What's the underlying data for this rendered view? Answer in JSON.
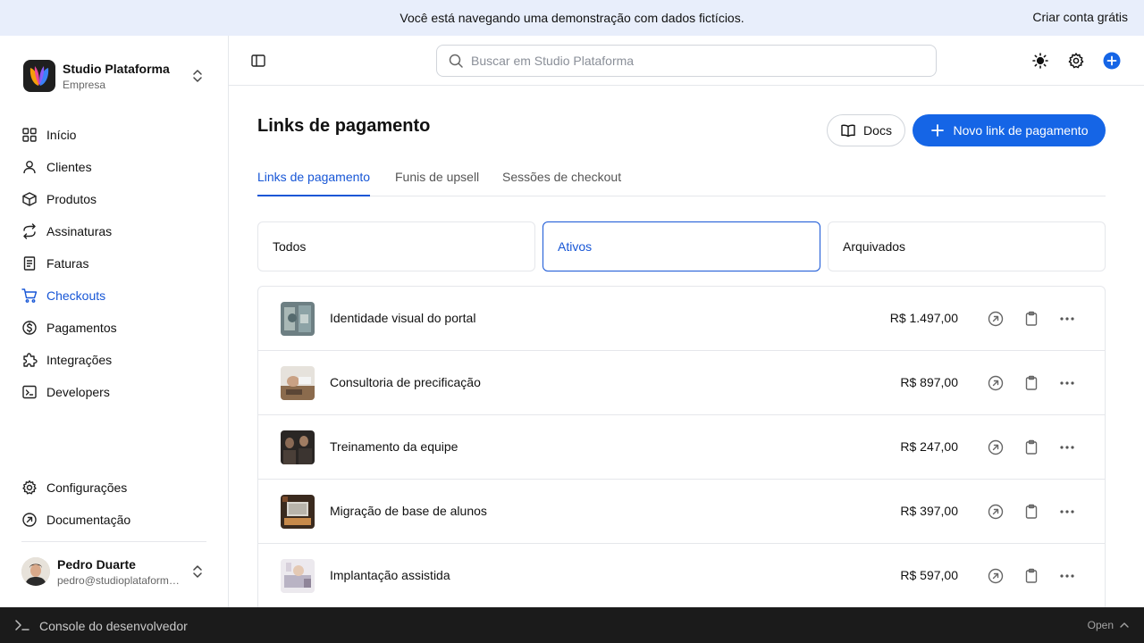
{
  "banner": {
    "message": "Você está navegando uma demonstração com dados fictícios.",
    "cta": "Criar conta grátis"
  },
  "org": {
    "name": "Studio Plataforma",
    "subtitle": "Empresa"
  },
  "sidebar": {
    "items": [
      {
        "label": "Início",
        "icon": "grid-icon"
      },
      {
        "label": "Clientes",
        "icon": "user-icon"
      },
      {
        "label": "Produtos",
        "icon": "box-icon"
      },
      {
        "label": "Assinaturas",
        "icon": "refresh-icon"
      },
      {
        "label": "Faturas",
        "icon": "invoice-icon"
      },
      {
        "label": "Checkouts",
        "icon": "cart-icon",
        "active": true
      },
      {
        "label": "Pagamentos",
        "icon": "dollar-icon"
      },
      {
        "label": "Integrações",
        "icon": "puzzle-icon"
      },
      {
        "label": "Developers",
        "icon": "terminal-icon"
      }
    ],
    "bottom": [
      {
        "label": "Configurações",
        "icon": "gear-icon"
      },
      {
        "label": "Documentação",
        "icon": "external-icon"
      }
    ]
  },
  "user": {
    "name": "Pedro Duarte",
    "email": "pedro@studioplataforma.com"
  },
  "search": {
    "placeholder": "Buscar em Studio Plataforma"
  },
  "page": {
    "title": "Links de pagamento",
    "docs_label": "Docs",
    "new_label": "Novo link de pagamento"
  },
  "tabs": [
    {
      "label": "Links de pagamento",
      "active": true
    },
    {
      "label": "Funis de upsell"
    },
    {
      "label": "Sessões de checkout"
    }
  ],
  "filters": [
    {
      "label": "Todos"
    },
    {
      "label": "Ativos",
      "active": true
    },
    {
      "label": "Arquivados"
    }
  ],
  "links": [
    {
      "name": "Identidade visual do portal",
      "price": "R$ 1.497,00"
    },
    {
      "name": "Consultoria de precificação",
      "price": "R$ 897,00"
    },
    {
      "name": "Treinamento da equipe",
      "price": "R$ 247,00"
    },
    {
      "name": "Migração de base de alunos",
      "price": "R$ 397,00"
    },
    {
      "name": "Implantação assistida",
      "price": "R$ 597,00"
    }
  ],
  "console": {
    "label": "Console do desenvolvedor",
    "open_label": "Open"
  },
  "colors": {
    "accent": "#1565e6",
    "active_text": "#1756d6",
    "banner_bg": "#e8eefb",
    "console_bg": "#1b1b1b"
  }
}
